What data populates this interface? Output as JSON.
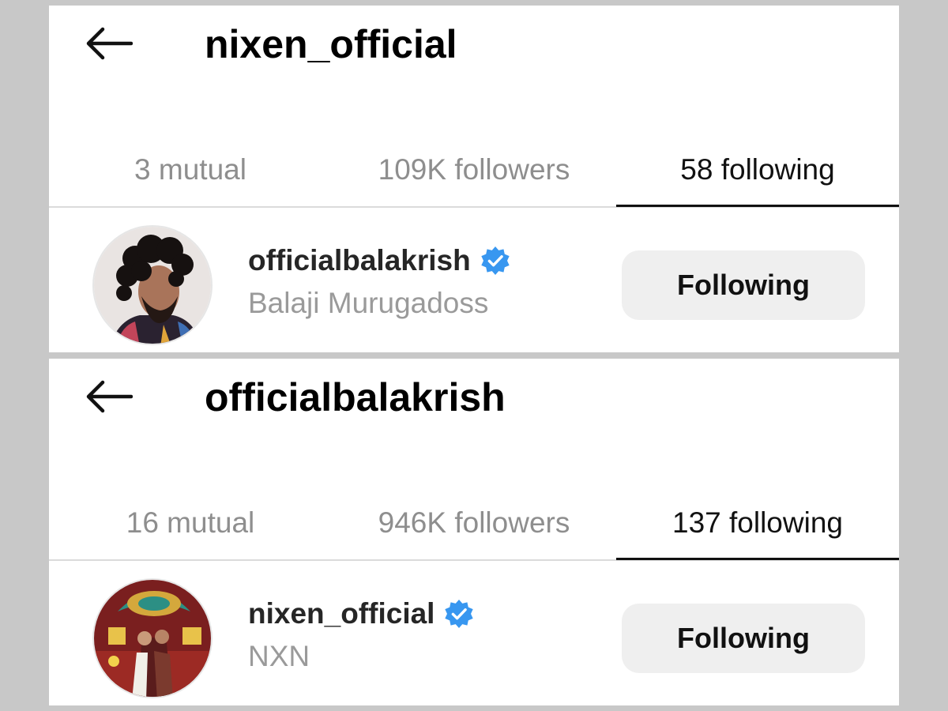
{
  "panels": [
    {
      "header": {
        "title": "nixen_official"
      },
      "tabs": {
        "mutual": "3 mutual",
        "followers": "109K followers",
        "following": "58 following"
      },
      "row": {
        "username": "officialbalakrish",
        "full_name": "Balaji Murugadoss",
        "button_label": "Following"
      }
    },
    {
      "header": {
        "title": "officialbalakrish"
      },
      "tabs": {
        "mutual": "16 mutual",
        "followers": "946K followers",
        "following": "137 following"
      },
      "row": {
        "username": "nixen_official",
        "full_name": "NXN",
        "button_label": "Following"
      }
    }
  ],
  "icons": {
    "back": "back-arrow-icon",
    "verified": "verified-badge-icon"
  },
  "colors": {
    "verified_blue": "#3897f0",
    "button_bg": "#efefef",
    "inactive_tab": "#8e8e8e"
  }
}
